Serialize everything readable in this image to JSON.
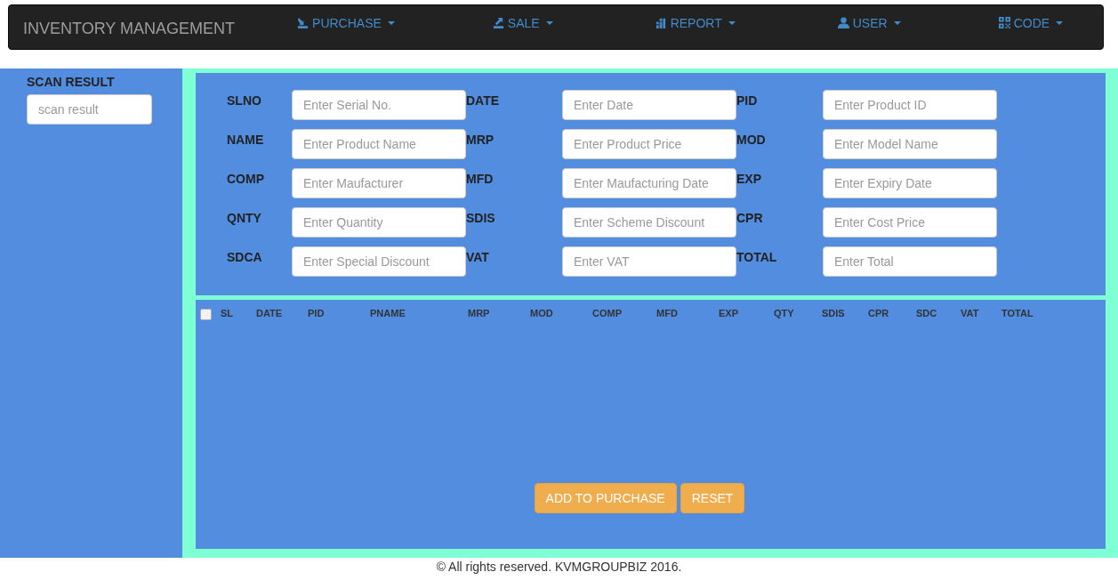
{
  "navbar": {
    "brand": "INVENTORY MANAGEMENT",
    "menus": [
      {
        "label": "PURCHASE",
        "kind": "purchase"
      },
      {
        "label": "SALE",
        "kind": "sale"
      },
      {
        "label": "REPORT",
        "kind": "report"
      },
      {
        "label": "USER",
        "kind": "user"
      },
      {
        "label": "CODE",
        "kind": "code"
      }
    ]
  },
  "sidebar": {
    "title": "SCAN RESULT",
    "field": {
      "placeholder": "scan result"
    }
  },
  "form": {
    "rows": [
      [
        {
          "label": "SLNO",
          "placeholder": "Enter Serial No."
        },
        {
          "label": "DATE",
          "placeholder": "Enter Date"
        },
        {
          "label": "PID",
          "placeholder": "Enter Product ID"
        }
      ],
      [
        {
          "label": "NAME",
          "placeholder": "Enter Product Name"
        },
        {
          "label": "MRP",
          "placeholder": "Enter Product Price"
        },
        {
          "label": "MOD",
          "placeholder": "Enter Model Name"
        }
      ],
      [
        {
          "label": "COMP",
          "placeholder": "Enter Maufacturer"
        },
        {
          "label": "MFD",
          "placeholder": "Enter Maufacturing Date"
        },
        {
          "label": "EXP",
          "placeholder": "Enter Expiry Date"
        }
      ],
      [
        {
          "label": "QNTY",
          "placeholder": "Enter Quantity"
        },
        {
          "label": "SDIS",
          "placeholder": "Enter Scheme Discount"
        },
        {
          "label": "CPR",
          "placeholder": "Enter Cost Price"
        }
      ],
      [
        {
          "label": "SDCA",
          "placeholder": "Enter Special Discount"
        },
        {
          "label": "VAT",
          "placeholder": "Enter VAT"
        },
        {
          "label": "TOTAL",
          "placeholder": "Enter Total"
        }
      ]
    ]
  },
  "table": {
    "select_all": {
      "checked": false
    },
    "columns": [
      "SL",
      "DATE",
      "PID",
      "PNAME",
      "MRP",
      "MOD",
      "COMP",
      "MFD",
      "EXP",
      "QTY",
      "SDIS",
      "CPR",
      "SDC",
      "VAT",
      "TOTAL"
    ]
  },
  "buttons": [
    "ADD TO PURCHASE",
    "RESET"
  ],
  "footer": "© All rights reserved. KVMGROUPBIZ 2016."
}
